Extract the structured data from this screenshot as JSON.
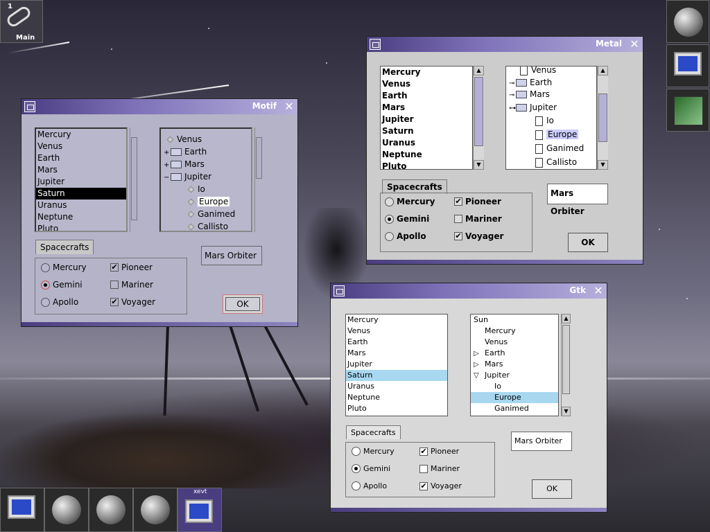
{
  "desktop": {
    "workspace_number": "1",
    "workspace_label": "Main",
    "taskbar_app_label": "xevt"
  },
  "motif": {
    "title": "Motif",
    "close_glyph": "✕",
    "list_items": [
      "Mercury",
      "Venus",
      "Earth",
      "Mars",
      "Jupiter",
      "Saturn",
      "Uranus",
      "Neptune",
      "Pluto"
    ],
    "selected_index": 5,
    "tree": {
      "venus": "Venus",
      "earth": "Earth",
      "mars": "Mars",
      "jupiter": "Jupiter",
      "io": "Io",
      "europe": "Europe",
      "ganimed": "Ganimed",
      "callisto": "Callisto"
    },
    "tab_label": "Spacecrafts",
    "radios": [
      "Mercury",
      "Gemini",
      "Apollo"
    ],
    "checks": [
      "Pioneer",
      "Mariner",
      "Voyager"
    ],
    "text_value": "Mars Orbiter",
    "ok_label": "OK"
  },
  "metal": {
    "title": "Metal",
    "close_glyph": "✕",
    "list_items": [
      "Mercury",
      "Venus",
      "Earth",
      "Mars",
      "Jupiter",
      "Saturn",
      "Uranus",
      "Neptune",
      "Pluto"
    ],
    "tree": {
      "venus": "Venus",
      "earth": "Earth",
      "mars": "Mars",
      "jupiter": "Jupiter",
      "io": "Io",
      "europe": "Europe",
      "ganimed": "Ganimed",
      "callisto": "Callisto"
    },
    "tab_label": "Spacecrafts",
    "radios": [
      "Mercury",
      "Gemini",
      "Apollo"
    ],
    "checks": [
      "Pioneer",
      "Mariner",
      "Voyager"
    ],
    "text_value": "Mars Orbiter",
    "ok_label": "OK"
  },
  "gtk": {
    "title": "Gtk",
    "close_glyph": "✕",
    "list_items": [
      "Mercury",
      "Venus",
      "Earth",
      "Mars",
      "Jupiter",
      "Saturn",
      "Uranus",
      "Neptune",
      "Pluto"
    ],
    "selected_index": 5,
    "tree": {
      "sun": "Sun",
      "mercury": "Mercury",
      "venus": "Venus",
      "earth": "Earth",
      "mars": "Mars",
      "jupiter": "Jupiter",
      "io": "Io",
      "europe": "Europe",
      "ganimed": "Ganimed"
    },
    "tab_label": "Spacecrafts",
    "radios": [
      "Mercury",
      "Gemini",
      "Apollo"
    ],
    "checks": [
      "Pioneer",
      "Mariner",
      "Voyager"
    ],
    "text_value": "Mars Orbiter",
    "ok_label": "OK"
  },
  "check_glyph": "✔",
  "colors": {
    "title_start": "#4a3d80",
    "title_end": "#b6b0dc",
    "gtk_selection": "#a8d8f0",
    "metal_selection": "#ccccff"
  }
}
